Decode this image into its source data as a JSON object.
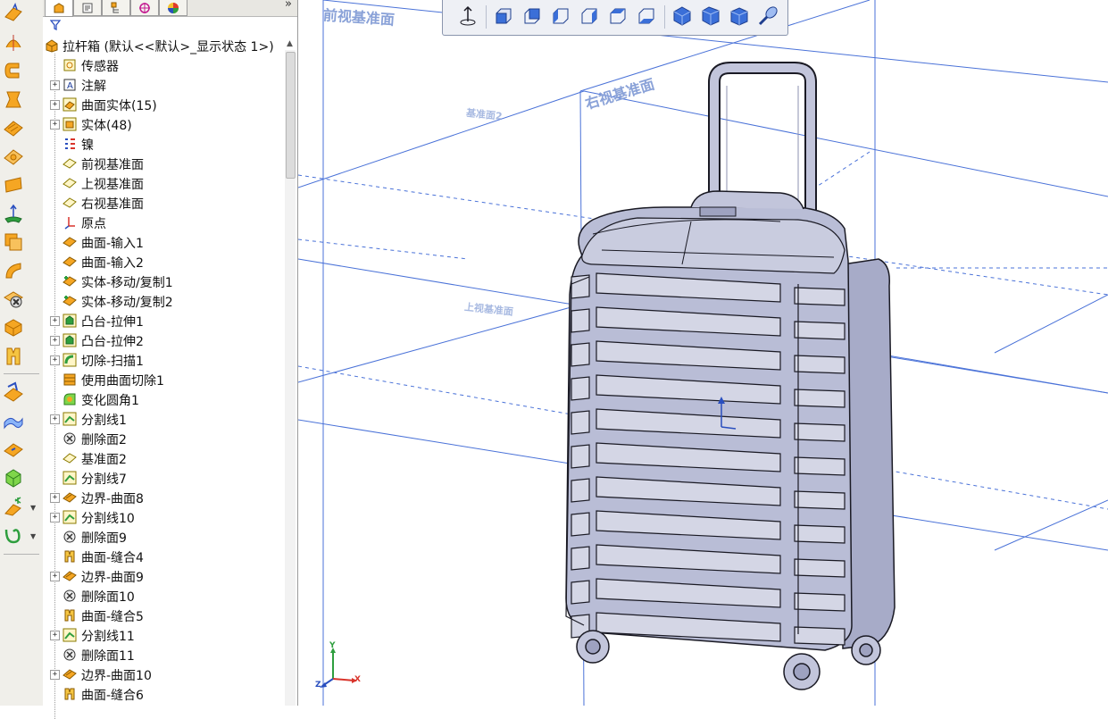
{
  "feature_tree": {
    "root": "拉杆箱 (默认<<默认>_显示状态 1>)",
    "items": [
      {
        "label": "传感器",
        "icon": "sensor-icon",
        "expandable": false
      },
      {
        "label": "注解",
        "icon": "annotations-icon",
        "expandable": true
      },
      {
        "label": "曲面实体(15)",
        "icon": "surface-bodies-icon",
        "expandable": true
      },
      {
        "label": "实体(48)",
        "icon": "solid-bodies-icon",
        "expandable": true
      },
      {
        "label": "镍",
        "icon": "material-icon",
        "expandable": false
      },
      {
        "label": "前视基准面",
        "icon": "plane-icon",
        "expandable": false
      },
      {
        "label": "上视基准面",
        "icon": "plane-icon",
        "expandable": false
      },
      {
        "label": "右视基准面",
        "icon": "plane-icon",
        "expandable": false
      },
      {
        "label": "原点",
        "icon": "origin-icon",
        "expandable": false
      },
      {
        "label": "曲面-输入1",
        "icon": "imported-surface-icon",
        "expandable": false
      },
      {
        "label": "曲面-输入2",
        "icon": "imported-surface-icon",
        "expandable": false
      },
      {
        "label": "实体-移动/复制1",
        "icon": "move-copy-icon",
        "expandable": false
      },
      {
        "label": "实体-移动/复制2",
        "icon": "move-copy-icon",
        "expandable": false
      },
      {
        "label": "凸台-拉伸1",
        "icon": "extrude-boss-icon",
        "expandable": true
      },
      {
        "label": "凸台-拉伸2",
        "icon": "extrude-boss-icon",
        "expandable": true
      },
      {
        "label": "切除-扫描1",
        "icon": "sweep-cut-icon",
        "expandable": true
      },
      {
        "label": "使用曲面切除1",
        "icon": "surface-cut-icon",
        "expandable": false
      },
      {
        "label": "变化圆角1",
        "icon": "variable-fillet-icon",
        "expandable": false
      },
      {
        "label": "分割线1",
        "icon": "split-line-icon",
        "expandable": true
      },
      {
        "label": "删除面2",
        "icon": "delete-face-icon",
        "expandable": false
      },
      {
        "label": "基准面2",
        "icon": "plane-icon",
        "expandable": false
      },
      {
        "label": "分割线7",
        "icon": "split-line-icon",
        "expandable": false
      },
      {
        "label": "边界-曲面8",
        "icon": "boundary-surface-icon",
        "expandable": true
      },
      {
        "label": "分割线10",
        "icon": "split-line-icon",
        "expandable": true
      },
      {
        "label": "删除面9",
        "icon": "delete-face-icon",
        "expandable": false
      },
      {
        "label": "曲面-缝合4",
        "icon": "knit-surface-icon",
        "expandable": false
      },
      {
        "label": "边界-曲面9",
        "icon": "boundary-surface-icon",
        "expandable": true
      },
      {
        "label": "删除面10",
        "icon": "delete-face-icon",
        "expandable": false
      },
      {
        "label": "曲面-缝合5",
        "icon": "knit-surface-icon",
        "expandable": false
      },
      {
        "label": "分割线11",
        "icon": "split-line-icon",
        "expandable": true
      },
      {
        "label": "删除面11",
        "icon": "delete-face-icon",
        "expandable": false
      },
      {
        "label": "边界-曲面10",
        "icon": "boundary-surface-icon",
        "expandable": true
      },
      {
        "label": "曲面-缝合6",
        "icon": "knit-surface-icon",
        "expandable": false
      }
    ]
  },
  "panel_tabs": [
    "feature-manager-tab",
    "property-manager-tab",
    "configuration-manager-tab",
    "dimxpert-tab",
    "display-manager-tab"
  ],
  "viewport": {
    "plane_labels": {
      "front": "前视基准面",
      "right": "右视基准面",
      "top": "上视基准面",
      "plane2": "基准面2"
    },
    "triad": {
      "x": "X",
      "y": "Y",
      "z": "Z"
    }
  },
  "heads_up_toolbar": [
    "normal-to-icon",
    "front-view-icon",
    "back-view-icon",
    "left-view-icon",
    "right-view-icon",
    "top-view-icon",
    "bottom-view-icon",
    "isometric-view-icon",
    "trimetric-view-icon",
    "dimetric-view-icon",
    "view-selector-icon"
  ],
  "colors": {
    "plane_edge": "#4a72d8",
    "plane_label": "#8aa2d8",
    "model_fill": "#b9bdd6",
    "model_edge": "#1a1a24"
  }
}
